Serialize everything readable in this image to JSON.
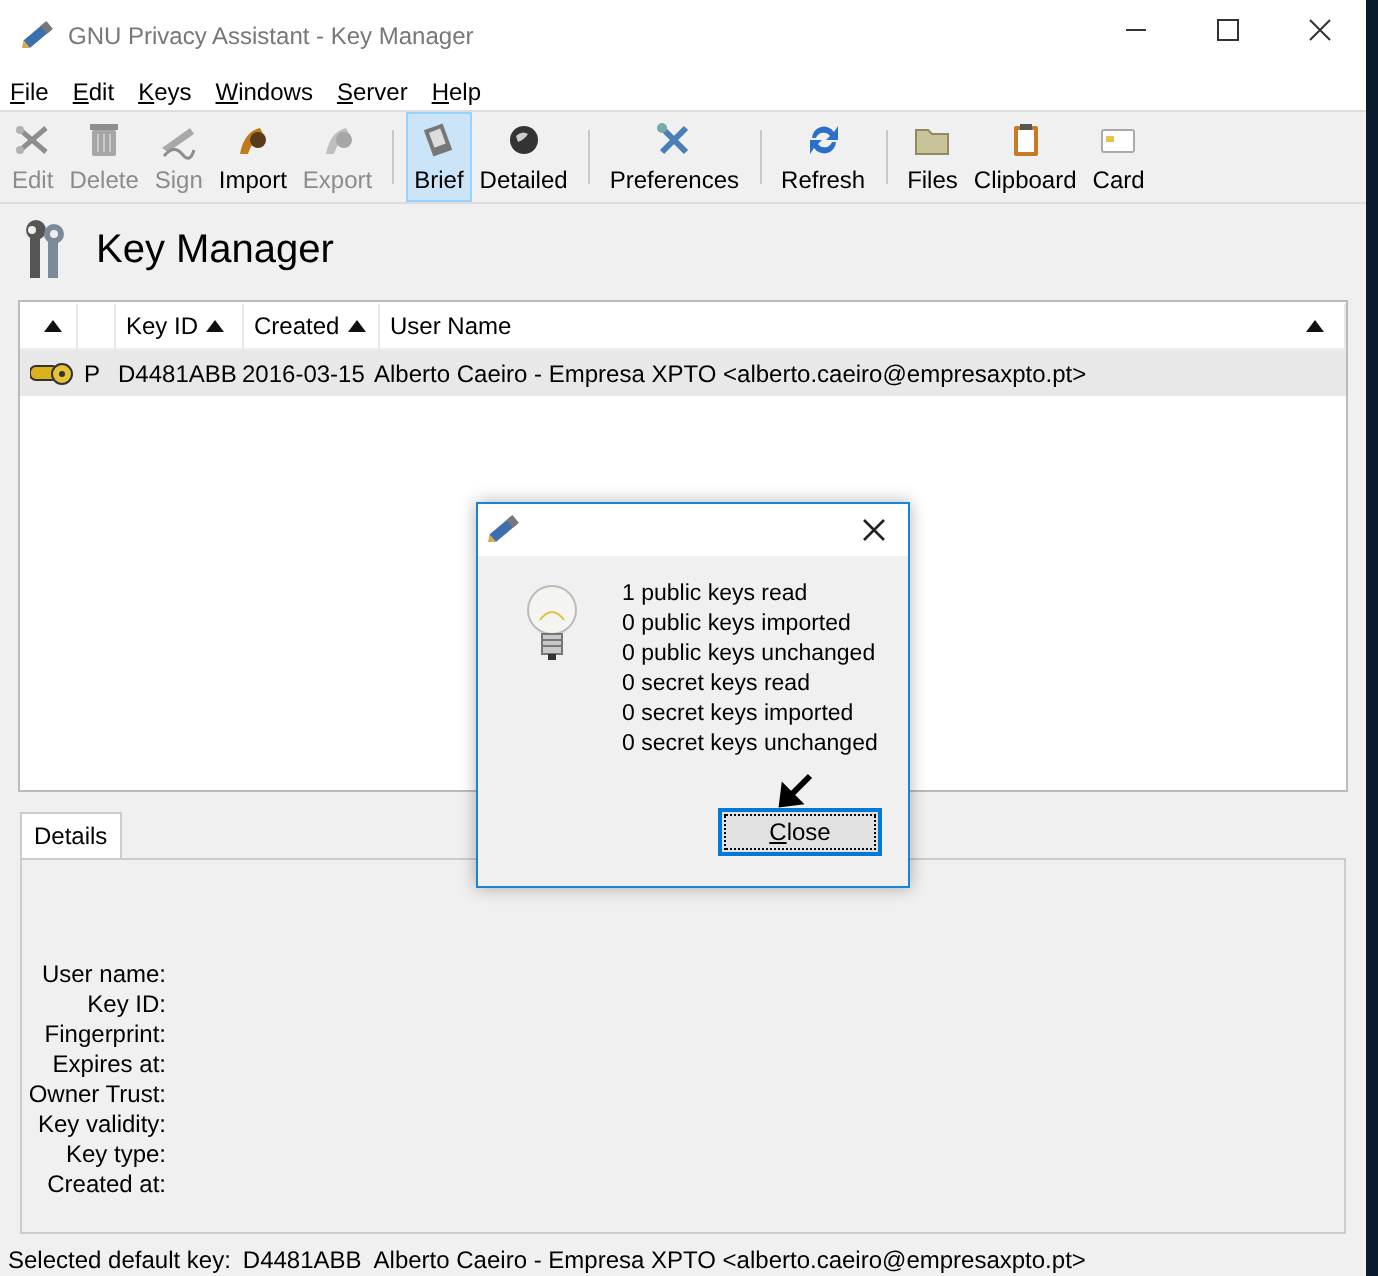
{
  "window": {
    "title": "GNU Privacy Assistant - Key Manager"
  },
  "menu": [
    "File",
    "Edit",
    "Keys",
    "Windows",
    "Server",
    "Help"
  ],
  "toolbar": [
    {
      "kind": "button",
      "label": "Edit",
      "disabled": true,
      "selected": false
    },
    {
      "kind": "button",
      "label": "Delete",
      "disabled": true,
      "selected": false
    },
    {
      "kind": "button",
      "label": "Sign",
      "disabled": true,
      "selected": false
    },
    {
      "kind": "button",
      "label": "Import",
      "disabled": false,
      "selected": false
    },
    {
      "kind": "button",
      "label": "Export",
      "disabled": true,
      "selected": false
    },
    {
      "kind": "separator"
    },
    {
      "kind": "button",
      "label": "Brief",
      "disabled": false,
      "selected": true
    },
    {
      "kind": "button",
      "label": "Detailed",
      "disabled": false,
      "selected": false
    },
    {
      "kind": "separator"
    },
    {
      "kind": "button",
      "label": "Preferences",
      "disabled": false,
      "selected": false
    },
    {
      "kind": "separator"
    },
    {
      "kind": "button",
      "label": "Refresh",
      "disabled": false,
      "selected": false
    },
    {
      "kind": "separator"
    },
    {
      "kind": "button",
      "label": "Files",
      "disabled": false,
      "selected": false
    },
    {
      "kind": "button",
      "label": "Clipboard",
      "disabled": false,
      "selected": false
    },
    {
      "kind": "button",
      "label": "Card",
      "disabled": false,
      "selected": false
    }
  ],
  "heading": "Key Manager",
  "table": {
    "columns": [
      {
        "sort_arrow": true
      },
      {
        "sort_arrow": false
      },
      {
        "label": "Key ID",
        "sort_arrow": true
      },
      {
        "label": "Created",
        "sort_arrow": true
      },
      {
        "label": "User Name",
        "sort_arrow": true
      }
    ],
    "rows": [
      {
        "selected": true,
        "type": "P",
        "key_id": "D4481ABB",
        "created": "2016-03-15",
        "user_name": "Alberto Caeiro - Empresa XPTO <alberto.caeiro@empresaxpto.pt>"
      }
    ]
  },
  "details": {
    "tab": "Details",
    "labels": [
      "User name:",
      "Key ID:",
      "Fingerprint:",
      "Expires at:",
      "Owner Trust:",
      "Key validity:",
      "Key type:",
      "Created at:"
    ]
  },
  "status_bar": {
    "label": "Selected default key:",
    "key_id": "D4481ABB",
    "user_name": "Alberto Caeiro - Empresa XPTO <alberto.caeiro@empresaxpto.pt>"
  },
  "dialog": {
    "lines": [
      "1 public keys read",
      "0 public keys imported",
      "0 public keys unchanged",
      "0 secret keys read",
      "0 secret keys imported",
      "0 secret keys unchanged"
    ],
    "button": "Close"
  }
}
